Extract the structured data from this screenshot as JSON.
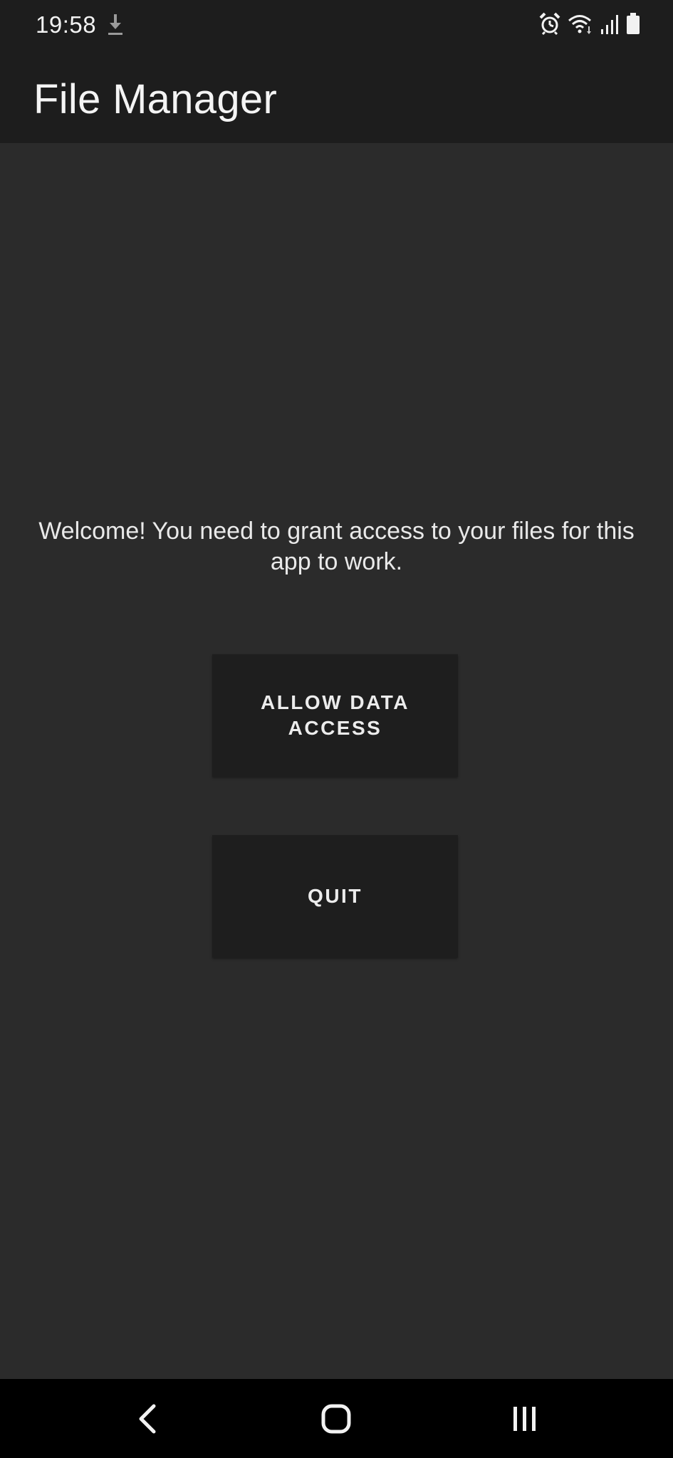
{
  "status_bar": {
    "time": "19:58",
    "icons": [
      "download-icon",
      "alarm-icon",
      "wifi-icon",
      "signal-icon",
      "battery-icon"
    ]
  },
  "app_bar": {
    "title": "File Manager"
  },
  "main": {
    "welcome_message": "Welcome! You need to grant access to your files for this app to work.",
    "allow_button_label": "ALLOW DATA ACCESS",
    "quit_button_label": "QUIT"
  },
  "nav_bar": {
    "buttons": [
      "back-icon",
      "home-icon",
      "recents-icon"
    ]
  },
  "colors": {
    "background": "#2b2b2b",
    "app_bar": "#1d1d1d",
    "button": "#1e1e1e",
    "text": "#ececec",
    "nav_bar": "#000000"
  }
}
